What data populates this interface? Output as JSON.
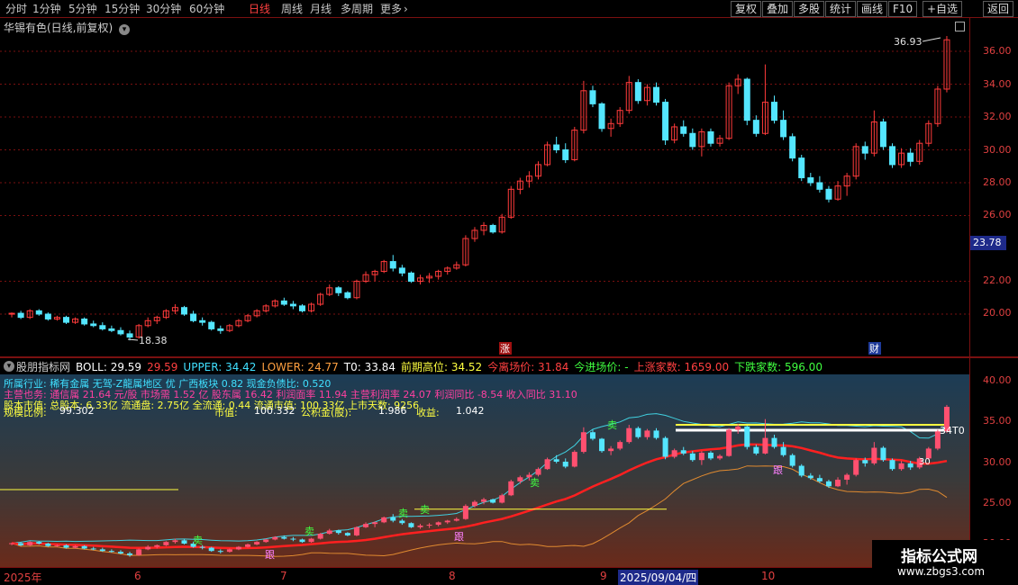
{
  "toolbar": {
    "periods": [
      "分时",
      "1分钟",
      "5分钟",
      "15分钟",
      "30分钟",
      "60分钟",
      "日线",
      "周线",
      "月线",
      "多周期",
      "更多"
    ],
    "active": "日线",
    "buttons": [
      "复权",
      "叠加",
      "多股",
      "统计",
      "画线",
      "F10",
      "+自选",
      "返回"
    ]
  },
  "stock": {
    "title": "华锡有色(日线,前复权)"
  },
  "main_axis": {
    "ticks": [
      "36.00",
      "34.00",
      "32.00",
      "30.00",
      "28.00",
      "26.00",
      "22.00",
      "20.00"
    ],
    "current_price": "23.78"
  },
  "annotations": {
    "high": "36.93",
    "low": "18.38",
    "zhang": "涨",
    "cai": "财"
  },
  "indicator_header": {
    "name": "股朋指标网",
    "items": [
      {
        "text": "BOLL: 29.59",
        "color": "#ffffff"
      },
      {
        "text": "29.59",
        "color": "#ff4040"
      },
      {
        "text": "UPPER: 34.42",
        "color": "#40e0ff"
      },
      {
        "text": "LOWER: 24.77",
        "color": "#ffa040"
      },
      {
        "text": "T0: 33.84",
        "color": "#ffffff"
      },
      {
        "text": "前期高位: 34.52",
        "color": "#ffff40"
      },
      {
        "text": "今离场价: 31.84",
        "color": "#ff4040"
      },
      {
        "text": "今进场价: -",
        "color": "#40ff40"
      },
      {
        "text": "上涨家数: 1659.00",
        "color": "#ff4040"
      },
      {
        "text": "下跌家数: 596.00",
        "color": "#40ff40"
      }
    ]
  },
  "sub_info": {
    "line1": "所属行业: 稀有金属  无驾-Z龍属地区 优 广西板块  0.82 现金负债比: 0.520",
    "line2": "主营也务: 通信属 21.64 元/股 市场需 1.52 亿 股东属 16.42 利润面率 11.94 主营利润率 24.07 利润同比 -8.54 收入同比 31.10",
    "line3": "股本市值: 总股本: 6.33亿 流通盘: 2.75亿 全流通: 0.44 流通市值: 100.33亿 上市天数: 9256",
    "line4_label1": "规模比例:",
    "line4_val1": "99.302",
    "line4_label2": "市值:",
    "line4_val2": "100.332",
    "line4_label3": "公积金(股):",
    "line4_val3": "1.986",
    "line4_label4": "收益:",
    "line4_val4": "1.042"
  },
  "sub_axis": {
    "ticks": [
      "40.00",
      "35.00",
      "30.00",
      "25.00",
      "20.00"
    ]
  },
  "sub_marks": {
    "mai": "卖",
    "gen": "跟",
    "t0": "34T0",
    "ban": "30"
  },
  "date_axis": [
    "2025年",
    "6",
    "7",
    "8",
    "9",
    "10"
  ],
  "date_cursor": "2025/09/04/四",
  "watermark": {
    "title": "指标公式网",
    "url": "www.zbgs3.com"
  },
  "colors": {
    "up": "#ff3b3b",
    "down": "#54e6ff",
    "bg": "#000000",
    "grid": "#7a1010"
  },
  "chart_data": {
    "type": "candlestick",
    "values": [
      [
        20.0,
        20.1,
        19.8,
        20.05
      ],
      [
        20.05,
        20.2,
        19.7,
        19.8
      ],
      [
        19.8,
        20.3,
        19.7,
        20.2
      ],
      [
        20.2,
        20.3,
        19.9,
        20.0
      ],
      [
        20.0,
        20.1,
        19.6,
        19.7
      ],
      [
        19.7,
        19.9,
        19.6,
        19.8
      ],
      [
        19.8,
        19.9,
        19.4,
        19.5
      ],
      [
        19.5,
        19.8,
        19.4,
        19.7
      ],
      [
        19.7,
        19.8,
        19.3,
        19.4
      ],
      [
        19.4,
        19.6,
        19.2,
        19.3
      ],
      [
        19.3,
        19.5,
        19.0,
        19.1
      ],
      [
        19.1,
        19.3,
        18.9,
        19.0
      ],
      [
        19.0,
        19.2,
        18.7,
        18.8
      ],
      [
        18.8,
        19.0,
        18.4,
        18.6
      ],
      [
        18.6,
        19.4,
        18.5,
        19.3
      ],
      [
        19.3,
        19.8,
        19.2,
        19.6
      ],
      [
        19.6,
        19.9,
        19.4,
        19.8
      ],
      [
        19.8,
        20.3,
        19.7,
        20.2
      ],
      [
        20.2,
        20.6,
        20.0,
        20.4
      ],
      [
        20.4,
        20.5,
        19.9,
        20.0
      ],
      [
        20.0,
        20.2,
        19.5,
        19.6
      ],
      [
        19.6,
        19.8,
        19.3,
        19.5
      ],
      [
        19.5,
        19.6,
        19.0,
        19.1
      ],
      [
        19.1,
        19.3,
        18.8,
        19.0
      ],
      [
        19.0,
        19.4,
        18.9,
        19.3
      ],
      [
        19.3,
        19.7,
        19.2,
        19.6
      ],
      [
        19.6,
        20.0,
        19.5,
        19.9
      ],
      [
        19.9,
        20.3,
        19.8,
        20.2
      ],
      [
        20.2,
        20.6,
        20.1,
        20.5
      ],
      [
        20.5,
        20.9,
        20.4,
        20.8
      ],
      [
        20.8,
        21.0,
        20.5,
        20.6
      ],
      [
        20.6,
        20.8,
        20.3,
        20.5
      ],
      [
        20.5,
        20.6,
        20.1,
        20.2
      ],
      [
        20.2,
        20.7,
        20.1,
        20.6
      ],
      [
        20.6,
        21.3,
        20.5,
        21.2
      ],
      [
        21.2,
        21.8,
        21.1,
        21.6
      ],
      [
        21.6,
        21.7,
        21.1,
        21.3
      ],
      [
        21.3,
        21.4,
        20.9,
        21.0
      ],
      [
        21.0,
        22.1,
        20.9,
        22.0
      ],
      [
        22.0,
        22.6,
        21.9,
        22.4
      ],
      [
        22.4,
        22.7,
        22.0,
        22.6
      ],
      [
        22.6,
        23.3,
        22.5,
        23.2
      ],
      [
        23.2,
        23.6,
        22.6,
        22.8
      ],
      [
        22.8,
        23.0,
        22.3,
        22.5
      ],
      [
        22.5,
        22.6,
        21.9,
        22.0
      ],
      [
        22.0,
        22.4,
        21.8,
        22.2
      ],
      [
        22.2,
        22.5,
        21.9,
        22.3
      ],
      [
        22.3,
        22.7,
        22.1,
        22.6
      ],
      [
        22.6,
        22.9,
        22.4,
        22.8
      ],
      [
        22.8,
        23.2,
        22.7,
        23.0
      ],
      [
        23.0,
        24.8,
        22.9,
        24.6
      ],
      [
        24.6,
        25.3,
        24.4,
        25.1
      ],
      [
        25.1,
        25.6,
        24.8,
        25.4
      ],
      [
        25.4,
        25.5,
        24.9,
        25.0
      ],
      [
        25.0,
        26.1,
        24.9,
        25.9
      ],
      [
        25.9,
        27.8,
        25.8,
        27.6
      ],
      [
        27.6,
        28.3,
        27.3,
        28.1
      ],
      [
        28.1,
        28.7,
        27.7,
        28.4
      ],
      [
        28.4,
        29.3,
        28.2,
        29.1
      ],
      [
        29.1,
        30.5,
        29.0,
        30.3
      ],
      [
        30.3,
        30.8,
        29.8,
        30.0
      ],
      [
        30.0,
        30.4,
        29.2,
        29.4
      ],
      [
        29.4,
        31.4,
        29.3,
        31.2
      ],
      [
        31.2,
        34.2,
        31.0,
        33.6
      ],
      [
        33.6,
        33.9,
        32.6,
        32.8
      ],
      [
        32.8,
        32.9,
        31.1,
        31.3
      ],
      [
        31.3,
        31.9,
        30.8,
        31.6
      ],
      [
        31.6,
        32.6,
        31.4,
        32.4
      ],
      [
        32.4,
        34.5,
        32.2,
        34.1
      ],
      [
        34.1,
        34.3,
        32.8,
        33.0
      ],
      [
        33.0,
        34.0,
        32.7,
        33.8
      ],
      [
        33.8,
        34.1,
        32.7,
        32.9
      ],
      [
        32.9,
        33.1,
        30.3,
        30.6
      ],
      [
        30.6,
        31.6,
        30.4,
        31.4
      ],
      [
        31.4,
        31.8,
        30.8,
        31.0
      ],
      [
        31.0,
        31.3,
        30.0,
        30.2
      ],
      [
        30.2,
        31.3,
        29.6,
        31.1
      ],
      [
        31.1,
        31.3,
        30.2,
        30.4
      ],
      [
        30.4,
        30.9,
        30.2,
        30.7
      ],
      [
        30.7,
        34.1,
        30.6,
        33.9
      ],
      [
        33.9,
        34.6,
        33.4,
        34.3
      ],
      [
        34.3,
        34.4,
        31.5,
        31.8
      ],
      [
        31.8,
        32.1,
        30.8,
        31.0
      ],
      [
        31.0,
        35.2,
        30.9,
        32.9
      ],
      [
        32.9,
        33.3,
        31.6,
        31.8
      ],
      [
        31.8,
        32.4,
        30.6,
        30.8
      ],
      [
        30.8,
        31.0,
        29.3,
        29.5
      ],
      [
        29.5,
        29.7,
        28.1,
        28.3
      ],
      [
        28.3,
        28.6,
        27.8,
        28.0
      ],
      [
        28.0,
        28.4,
        27.4,
        27.6
      ],
      [
        27.6,
        27.8,
        26.8,
        27.0
      ],
      [
        27.0,
        28.1,
        26.9,
        27.8
      ],
      [
        27.8,
        28.6,
        27.2,
        28.4
      ],
      [
        28.4,
        30.4,
        28.2,
        30.2
      ],
      [
        30.2,
        30.5,
        29.4,
        29.8
      ],
      [
        29.8,
        32.4,
        29.6,
        31.7
      ],
      [
        31.7,
        31.9,
        30.0,
        30.2
      ],
      [
        30.2,
        30.4,
        28.9,
        29.1
      ],
      [
        29.1,
        30.1,
        28.9,
        29.8
      ],
      [
        29.8,
        30.1,
        29.0,
        29.3
      ],
      [
        29.3,
        30.6,
        29.1,
        30.4
      ],
      [
        30.4,
        31.8,
        30.2,
        31.6
      ],
      [
        31.6,
        33.9,
        31.4,
        33.7
      ],
      [
        33.7,
        36.93,
        33.5,
        36.7
      ]
    ]
  }
}
